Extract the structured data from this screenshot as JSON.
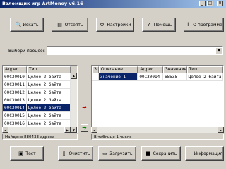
{
  "window": {
    "title": "Взломщик игр ArtMoney v6.16"
  },
  "toolbar": [
    {
      "label": "Искать",
      "icon": "search-icon",
      "glyph": "🔍"
    },
    {
      "label": "Отсеять",
      "icon": "filter-icon",
      "glyph": "▤"
    },
    {
      "label": "Настройки",
      "icon": "settings-icon",
      "glyph": "⚙"
    },
    {
      "label": "Помощь",
      "icon": "help-icon",
      "glyph": "?"
    },
    {
      "label": "О программе",
      "icon": "info-icon",
      "glyph": "i"
    }
  ],
  "process": {
    "label": "Выбери процесс",
    "value": ""
  },
  "left_table": {
    "columns": [
      "Адрес",
      "Тип"
    ],
    "rows": [
      {
        "addr": "00C30010",
        "type": "Целое 2 байта",
        "selected": false
      },
      {
        "addr": "00C30011",
        "type": "Целое 2 байта",
        "selected": false
      },
      {
        "addr": "00C30012",
        "type": "Целое 2 байта",
        "selected": false
      },
      {
        "addr": "00C30013",
        "type": "Целое 2 байта",
        "selected": false
      },
      {
        "addr": "00C30014",
        "type": "Целое 2 байта",
        "selected": true
      },
      {
        "addr": "00C30015",
        "type": "Целое 2 байта",
        "selected": false
      },
      {
        "addr": "00C30016",
        "type": "Целое 2 байта",
        "selected": false
      },
      {
        "addr": "00C30017",
        "type": "Целое 2 байта",
        "selected": false
      }
    ],
    "status": "Найдено 880433 адреса"
  },
  "right_table": {
    "columns": [
      "З",
      "Описание",
      "Адрес",
      "Значение",
      "Тип"
    ],
    "rows": [
      {
        "frozen": "",
        "desc": "Значение 1",
        "addr": "00C30014",
        "value": "65535",
        "type": "Целое 2 байта"
      }
    ],
    "status": "В таблице 1 число"
  },
  "bottom_buttons": [
    {
      "label": "Тест",
      "icon": "test-icon",
      "glyph": "▣"
    },
    {
      "label": "Очистить",
      "icon": "clear-icon",
      "glyph": "▯"
    },
    {
      "label": "Загрузить",
      "icon": "open-icon",
      "glyph": "▭"
    },
    {
      "label": "Сохранить",
      "icon": "save-icon",
      "glyph": "■"
    },
    {
      "label": "Информация",
      "icon": "info-icon",
      "glyph": "i"
    }
  ]
}
